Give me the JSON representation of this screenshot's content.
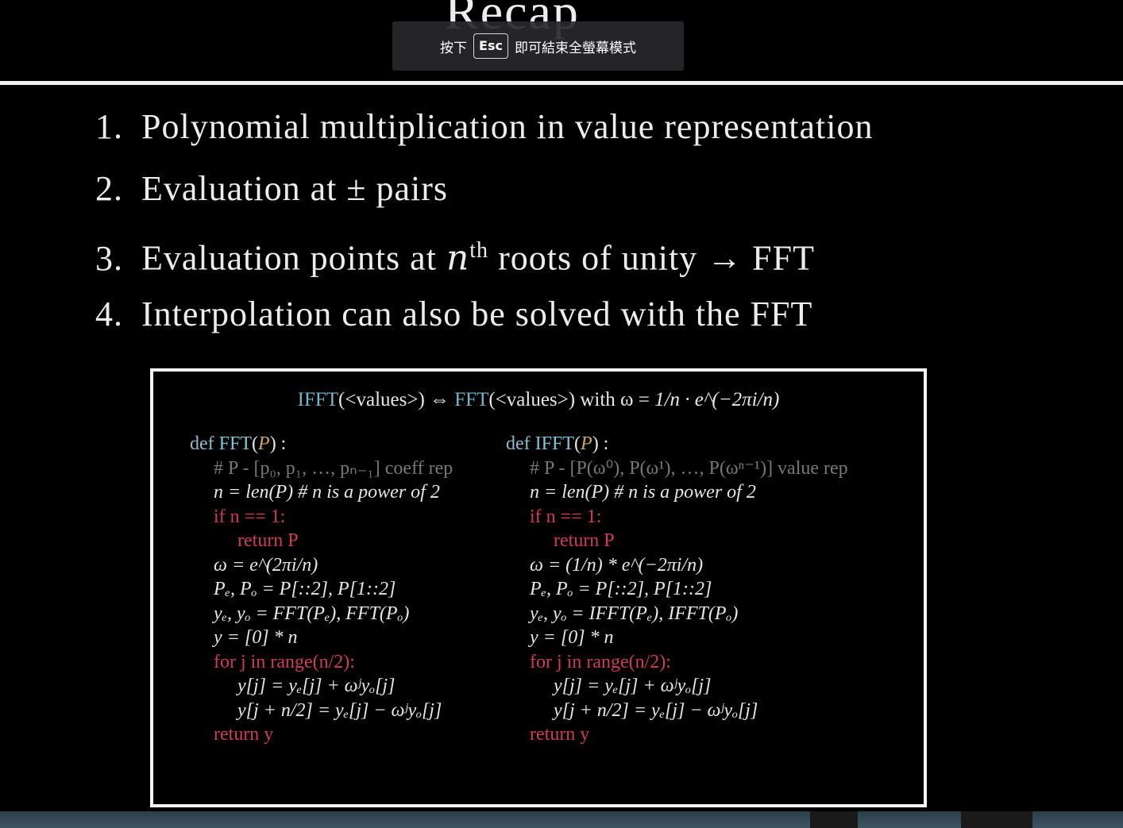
{
  "slide": {
    "title": "Recap",
    "points": [
      {
        "num": "1.",
        "text": "Polynomial multiplication in value representation"
      },
      {
        "num": "2.",
        "text": "Evaluation at ± pairs"
      },
      {
        "num": "3.",
        "pre": "Evaluation points at ",
        "var": "n",
        "sup": "th",
        "post": " roots of unity → FFT"
      },
      {
        "num": "4.",
        "text": "Interpolation can also be solved with the FFT"
      }
    ]
  },
  "banner": {
    "prefix": "按下",
    "key": "Esc",
    "suffix": "即可結束全螢幕模式"
  },
  "code": {
    "formula": {
      "ifft": "IFFT",
      "ifft_args": "(<values>) ⇔ ",
      "fft": "FFT",
      "fft_args": "(<values>) with ω = ",
      "tail": "1/n · e^(−2πi/n)"
    },
    "fft": {
      "header_kw": "def ",
      "name": "FFT",
      "param": "P",
      "lines": [
        "# P - [p₀, p₁, …, pₙ₋₁] coeff rep",
        "n = len(P) # n is a power of 2",
        "if n == 1:",
        "return P",
        "ω = e^(2πi/n)",
        "Pₑ, Pₒ = P[::2], P[1::2]",
        "yₑ, yₒ = FFT(Pₑ), FFT(Pₒ)",
        "y = [0] * n",
        "for j in range(n/2):",
        "y[j] = yₑ[j] + ωʲyₒ[j]",
        "y[j + n/2] = yₑ[j] − ωʲyₒ[j]",
        "return y"
      ]
    },
    "ifft": {
      "header_kw": "def ",
      "name": "IFFT",
      "param": "P",
      "lines": [
        "# P - [P(ω⁰), P(ω¹), …, P(ωⁿ⁻¹)] value rep",
        "n = len(P) # n is a power of 2",
        "if n == 1:",
        "return P",
        "ω = (1/n) * e^(−2πi/n)",
        "Pₑ, Pₒ = P[::2], P[1::2]",
        "yₑ, yₒ = IFFT(Pₑ), IFFT(Pₒ)",
        "y = [0] * n",
        "for j in range(n/2):",
        "y[j] = yₑ[j] + ωʲyₒ[j]",
        "y[j + n/2] = yₑ[j] − ωʲyₒ[j]",
        "return y"
      ]
    }
  },
  "colors": {
    "keyword": "#d23a5a",
    "function": "#7cc6d8",
    "param": "#c9a85a",
    "comment": "#777777"
  }
}
